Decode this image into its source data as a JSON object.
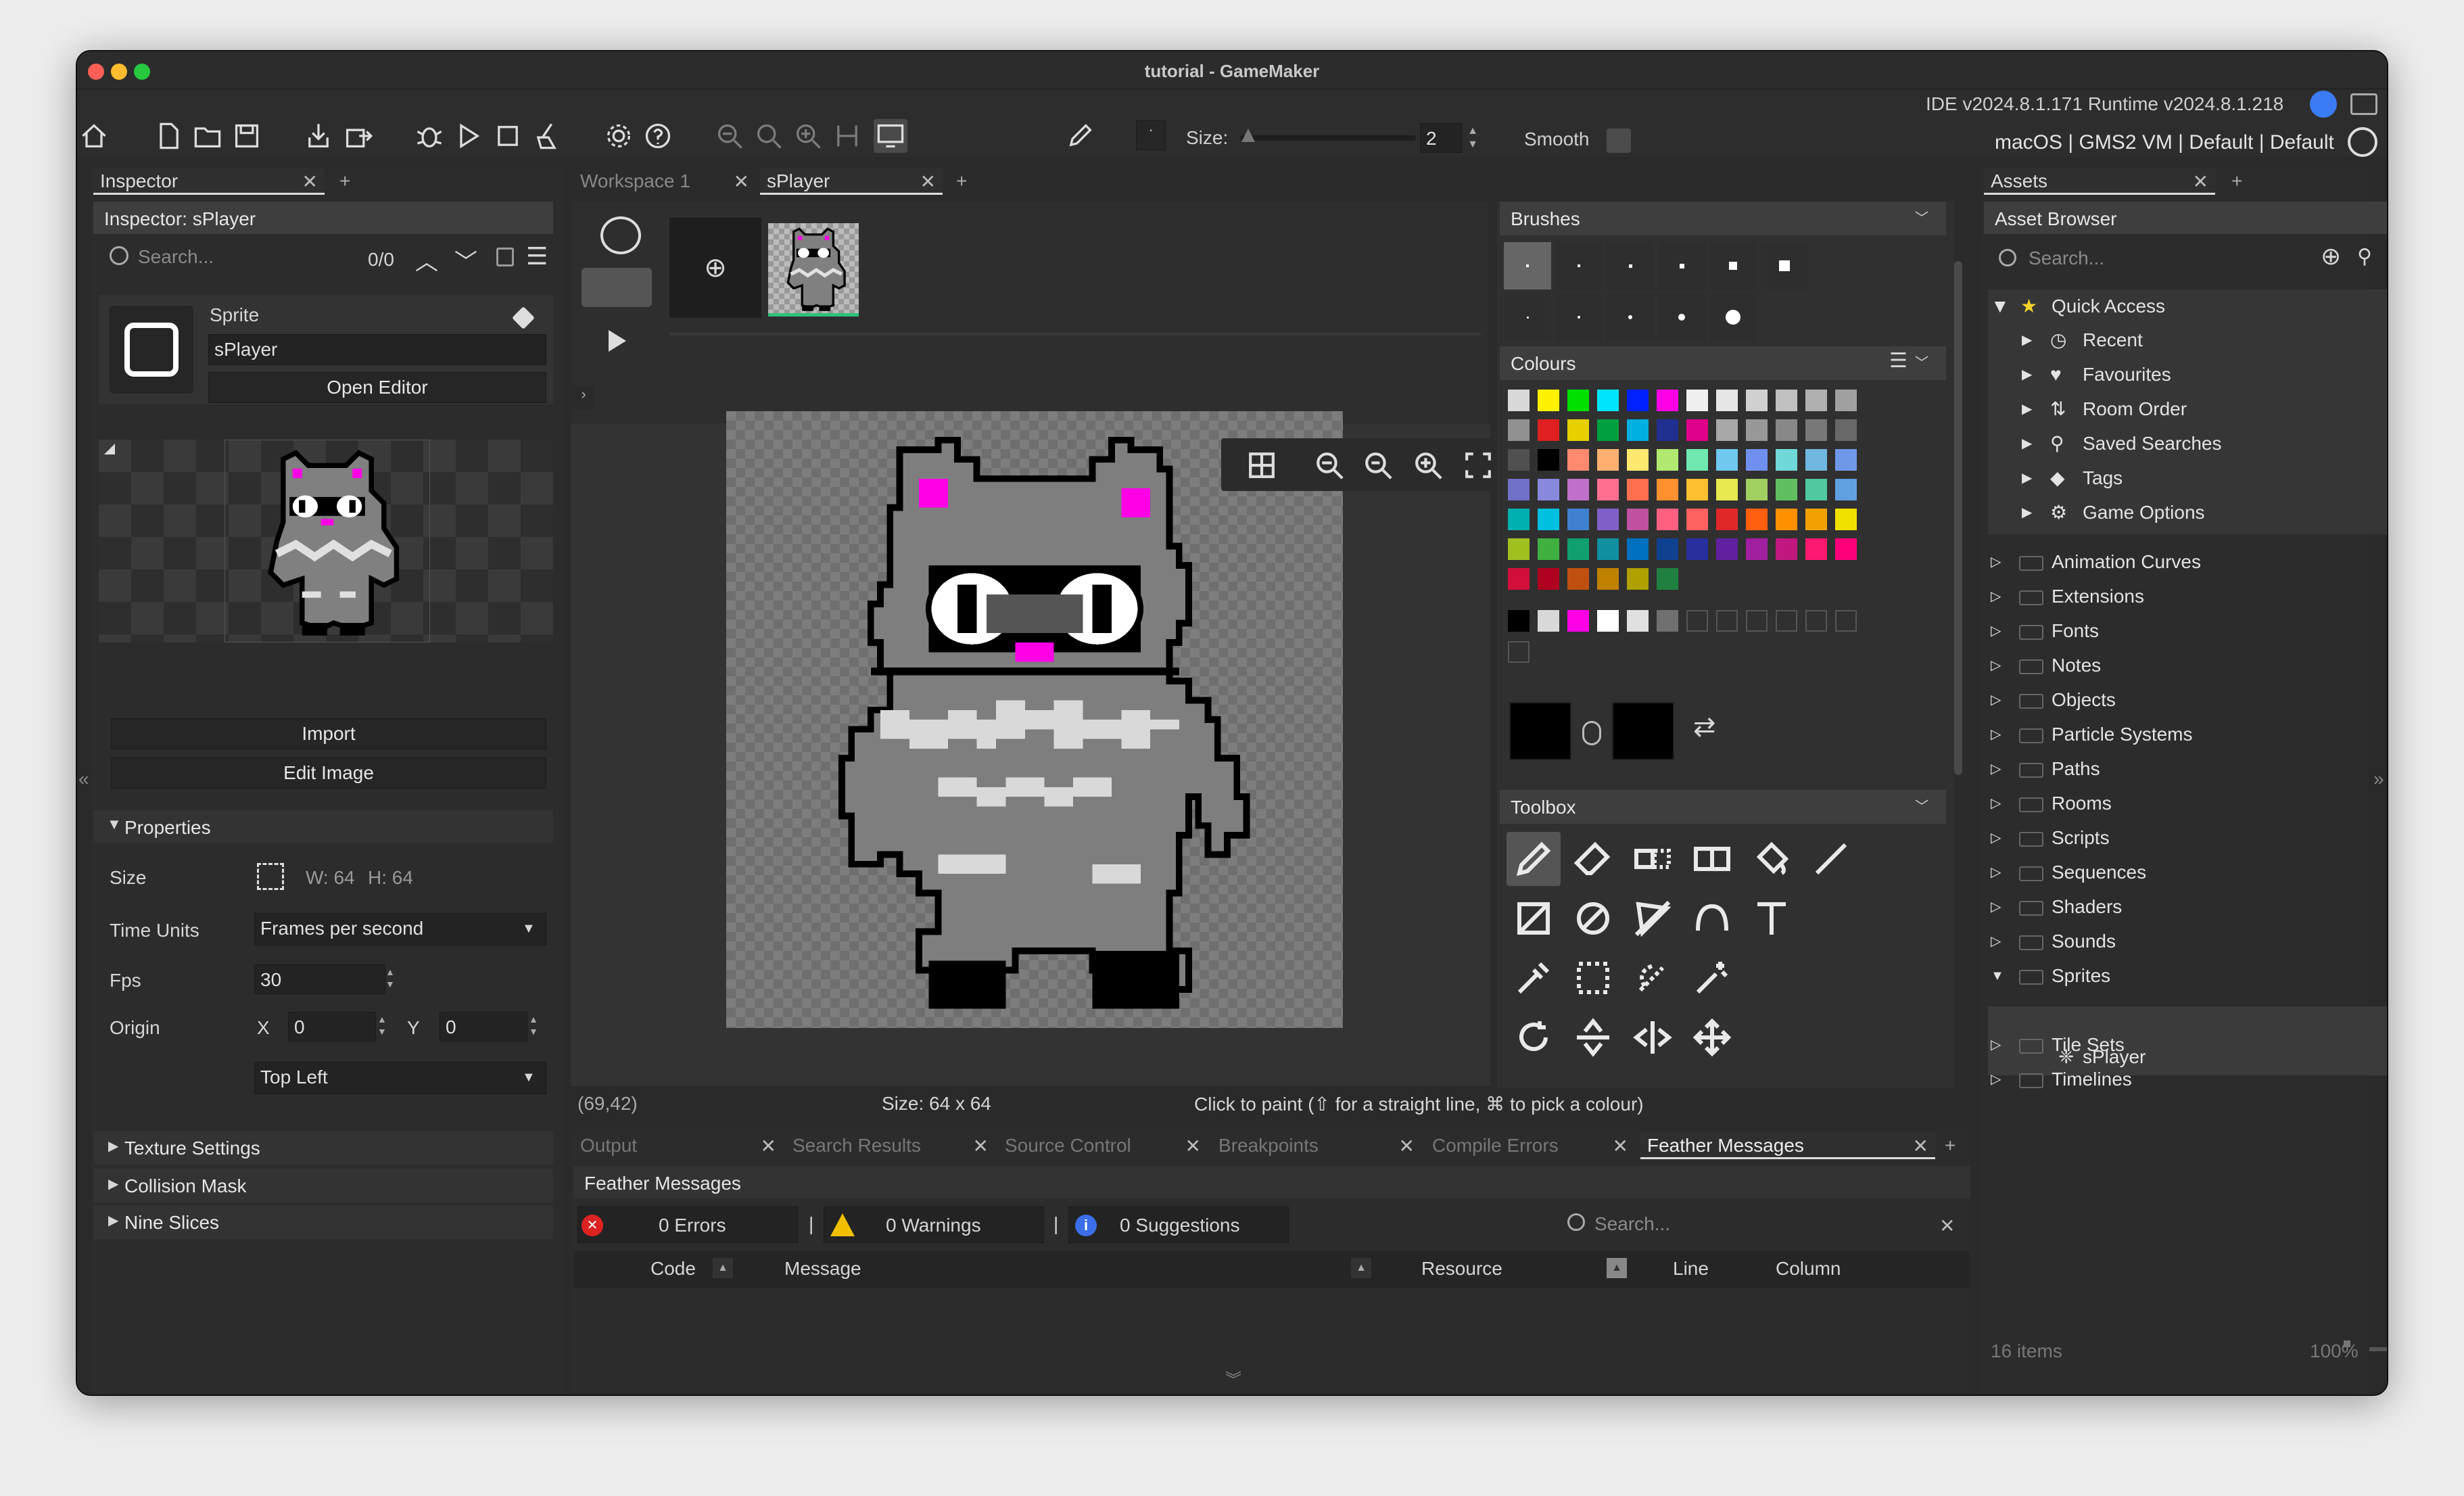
{
  "window": {
    "title": "tutorial - GameMaker"
  },
  "toolbar": {
    "version": "IDE v2024.8.1.171  Runtime v2024.8.1.218",
    "target": "macOS | GMS2 VM | Default | Default",
    "size_label": "Size:",
    "size_value": "2",
    "smooth_label": "Smooth"
  },
  "inspector": {
    "tab": "Inspector",
    "title": "Inspector: sPlayer",
    "search_placeholder": "Search...",
    "search_count": "0/0",
    "sprite_label": "Sprite",
    "sprite_name": "sPlayer",
    "open_editor": "Open Editor",
    "import": "Import",
    "edit_image": "Edit Image",
    "properties": "Properties",
    "size_label": "Size",
    "width": "W: 64",
    "height": "H: 64",
    "time_units_label": "Time Units",
    "time_units_value": "Frames per second",
    "fps_label": "Fps",
    "fps_value": "30",
    "origin_label": "Origin",
    "x_label": "X",
    "x_value": "0",
    "y_label": "Y",
    "y_value": "0",
    "origin_preset": "Top Left",
    "sections": [
      "Texture Settings",
      "Collision Mask",
      "Nine Slices"
    ]
  },
  "editor": {
    "tabs": [
      "Workspace 1",
      "sPlayer"
    ],
    "status_coords": "(69,42)",
    "status_size": "Size: 64 x 64",
    "status_hint": "Click to paint (⇧ for a straight line, ⌘ to pick a colour)"
  },
  "brushes": {
    "title": "Brushes"
  },
  "colours": {
    "title": "Colours",
    "palette": [
      [
        "#d8d8d8",
        "#fff200",
        "#00e000",
        "#00e5ff",
        "#0022ff",
        "#ff00e6",
        "#f0f0f0",
        "#e6e6e6",
        "#d0d0d0",
        "#c0c0c0",
        "#b0b0b0",
        "#a0a0a0"
      ],
      [
        "#909090",
        "#e02020",
        "#e8d000",
        "#00a040",
        "#00b0e0",
        "#203090",
        "#e0008a",
        "#a8a8a8",
        "#989898",
        "#888888",
        "#787878",
        "#686868"
      ],
      [
        "#505050",
        "#000000",
        "#ff8a70",
        "#ffb070",
        "#ffe870",
        "#b0e870",
        "#70e8b0",
        "#70c8f0",
        "#7090f0",
        "#70d8d8",
        "#70b8e0",
        "#7098e8"
      ],
      [
        "#7070c8",
        "#8888dd",
        "#c070c8",
        "#ff7090",
        "#ff7050",
        "#ff9030",
        "#ffc030",
        "#e8e850",
        "#a0d060",
        "#60c060",
        "#50c8a0",
        "#60a0e0"
      ],
      [
        "#00b0b0",
        "#00c0e0",
        "#4080d0",
        "#8060c8",
        "#c050a0",
        "#ff6080",
        "#ff6060",
        "#e02828",
        "#ff6010",
        "#ff9000",
        "#f0a000",
        "#f0e000"
      ],
      [
        "#a0c020",
        "#40b040",
        "#10a070",
        "#1090a0",
        "#0070c0",
        "#104090",
        "#2830a0",
        "#6020a0",
        "#a020a0",
        "#c01880",
        "#ff1870",
        "#ff007a"
      ],
      [
        "#d0103a",
        "#b00020",
        "#c05010",
        "#c08000",
        "#b0a000",
        "#208040"
      ]
    ],
    "recent": [
      "#000000",
      "#d8d8d8",
      "#ff00e6",
      "#ffffff",
      "#e0e0e0",
      "#707070"
    ]
  },
  "toolbox": {
    "title": "Toolbox"
  },
  "assets": {
    "tab": "Assets",
    "title": "Asset Browser",
    "search_placeholder": "Search...",
    "quick_access": "Quick Access",
    "quick_items": [
      "Recent",
      "Favourites",
      "Room Order",
      "Saved Searches",
      "Tags",
      "Game Options"
    ],
    "folders": [
      "Animation Curves",
      "Extensions",
      "Fonts",
      "Notes",
      "Objects",
      "Particle Systems",
      "Paths",
      "Rooms",
      "Scripts",
      "Sequences",
      "Shaders",
      "Sounds",
      "Sprites",
      "Tile Sets",
      "Timelines"
    ],
    "sprite_item": "sPlayer",
    "count": "16 items",
    "zoom": "100%"
  },
  "output": {
    "tabs": [
      "Output",
      "Search Results",
      "Source Control",
      "Breakpoints",
      "Compile Errors",
      "Feather Messages"
    ],
    "title": "Feather Messages",
    "errors": "0 Errors",
    "warnings": "0 Warnings",
    "suggestions": "0 Suggestions",
    "search_placeholder": "Search...",
    "columns": [
      "Code",
      "Message",
      "Resource",
      "Line",
      "Column"
    ]
  }
}
